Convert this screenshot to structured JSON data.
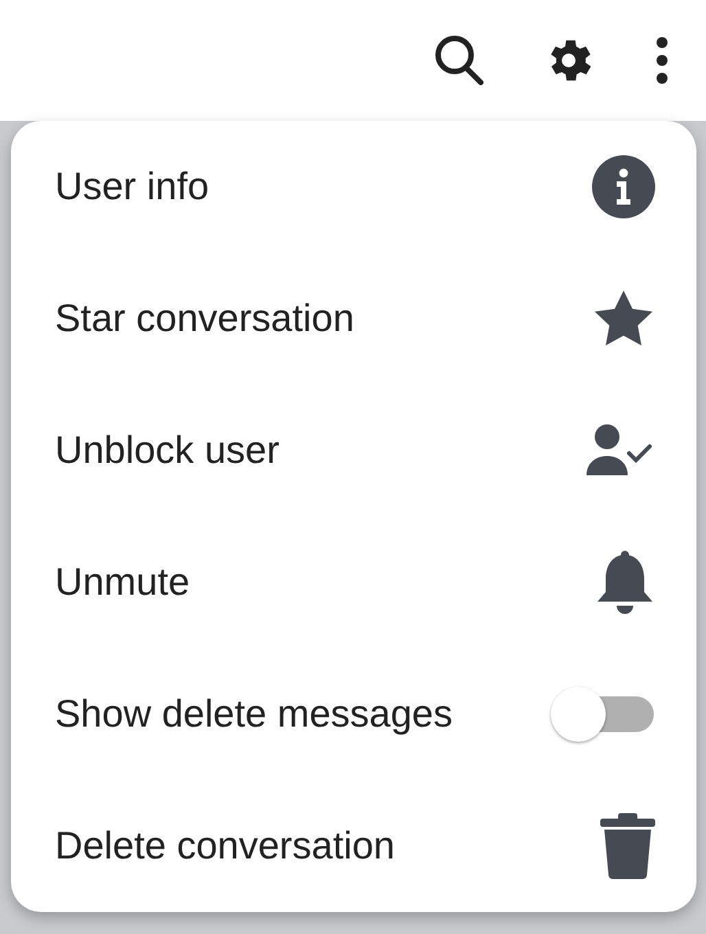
{
  "menu": {
    "items": [
      {
        "label": "User info",
        "kind": "action"
      },
      {
        "label": "Star conversation",
        "kind": "action"
      },
      {
        "label": "Unblock user",
        "kind": "action"
      },
      {
        "label": "Unmute",
        "kind": "action"
      },
      {
        "label": "Show delete messages",
        "kind": "toggle",
        "on": false
      },
      {
        "label": "Delete conversation",
        "kind": "action"
      }
    ]
  }
}
